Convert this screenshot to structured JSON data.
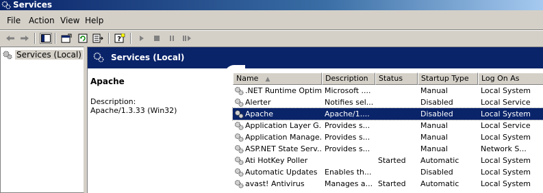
{
  "window": {
    "title": "Services"
  },
  "menu": [
    "File",
    "Action",
    "View",
    "Help"
  ],
  "tree": {
    "root_label": "Services (Local)"
  },
  "panel": {
    "title": "Services (Local)"
  },
  "details": {
    "service_name": "Apache",
    "description_label": "Description:",
    "description_value": "Apache/1.3.33 (Win32)"
  },
  "list": {
    "columns": [
      "Name",
      "Description",
      "Status",
      "Startup Type",
      "Log On As"
    ],
    "rows": [
      {
        "name": ".NET Runtime Optim...",
        "description": "Microsoft ....",
        "status": "",
        "startup": "Manual",
        "logon": "Local System"
      },
      {
        "name": "Alerter",
        "description": "Notifies sel...",
        "status": "",
        "startup": "Disabled",
        "logon": "Local Service"
      },
      {
        "name": "Apache",
        "description": "Apache/1....",
        "status": "",
        "startup": "Disabled",
        "logon": "Local System",
        "selected": true
      },
      {
        "name": "Application Layer G...",
        "description": "Provides s...",
        "status": "",
        "startup": "Manual",
        "logon": "Local Service"
      },
      {
        "name": "Application Manage...",
        "description": "Provides s...",
        "status": "",
        "startup": "Manual",
        "logon": "Local System"
      },
      {
        "name": "ASP.NET State Serv...",
        "description": "Provides s...",
        "status": "",
        "startup": "Manual",
        "logon": "Network S..."
      },
      {
        "name": "Ati HotKey Poller",
        "description": "",
        "status": "Started",
        "startup": "Automatic",
        "logon": "Local System"
      },
      {
        "name": "Automatic Updates",
        "description": "Enables th...",
        "status": "",
        "startup": "Disabled",
        "logon": "Local System"
      },
      {
        "name": "avast! Antivirus",
        "description": "Manages a...",
        "status": "Started",
        "startup": "Automatic",
        "logon": "Local System"
      }
    ]
  },
  "colors": {
    "title_bar": "#0a246a",
    "selection": "#0a246a",
    "chrome": "#d4d0c8"
  }
}
